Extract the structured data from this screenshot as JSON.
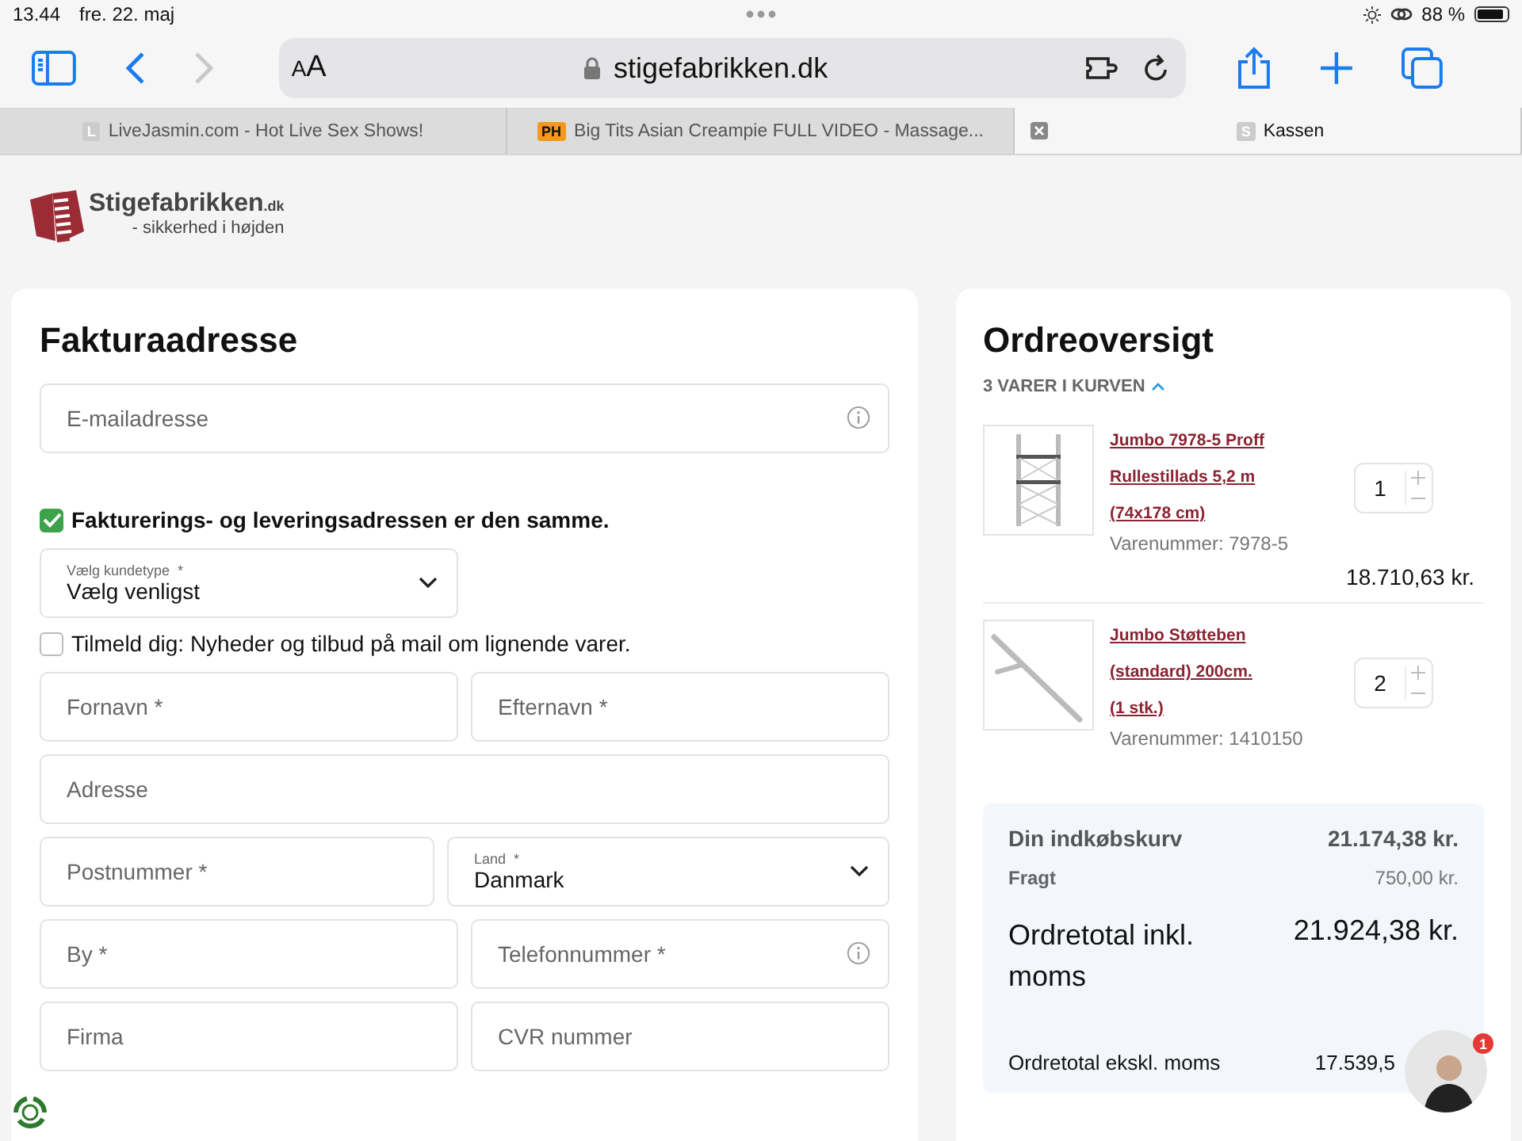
{
  "status_bar": {
    "time": "13.44",
    "date": "fre. 22. maj",
    "battery": "88 %"
  },
  "toolbar": {
    "text_size": "AA",
    "address": "stigefabrikken.dk"
  },
  "tabs": [
    {
      "favicon": "L",
      "label": "LiveJasmin.com - Hot Live Sex Shows!",
      "selected": false
    },
    {
      "favicon": "PH",
      "label": "Big Tits Asian Creampie FULL VIDEO - Massage...",
      "selected": false
    },
    {
      "favicon": "S",
      "label": "Kassen",
      "selected": true
    }
  ],
  "logo": {
    "name": "Stigefabrikken",
    "suffix": ".dk",
    "tagline": "- sikkerhed i højden"
  },
  "billing": {
    "title": "Fakturaadresse",
    "rows": [
      {
        "kind": "fields",
        "fields": [
          {
            "kind": "input",
            "placeholder": "E-mailadresse",
            "info": true
          }
        ]
      },
      {
        "kind": "checkbox",
        "label": "Fakturerings- og leveringsadressen er den samme.",
        "checked": true,
        "bold": true
      },
      {
        "kind": "fields",
        "half": true,
        "fields": [
          {
            "kind": "select",
            "label": "Vælg kundetype  *",
            "value": "Vælg venligst"
          }
        ]
      },
      {
        "kind": "checkbox",
        "label": "Tilmeld dig: Nyheder og tilbud på mail om lignende varer.",
        "checked": false,
        "bold": false
      },
      {
        "kind": "fields",
        "fields": [
          {
            "kind": "input",
            "placeholder": "Fornavn *"
          },
          {
            "kind": "input",
            "placeholder": "Efternavn *"
          }
        ]
      },
      {
        "kind": "fields",
        "fields": [
          {
            "kind": "input",
            "placeholder": "Adresse"
          }
        ]
      },
      {
        "kind": "fields",
        "fields": [
          {
            "kind": "input",
            "placeholder": "Postnummer *"
          },
          {
            "kind": "select",
            "label": "Land  *",
            "value": "Danmark"
          }
        ]
      },
      {
        "kind": "fields",
        "fields": [
          {
            "kind": "input",
            "placeholder": "By *"
          },
          {
            "kind": "input",
            "placeholder": "Telefonnummer *",
            "info": true
          }
        ]
      },
      {
        "kind": "fields",
        "fields": [
          {
            "kind": "input",
            "placeholder": "Firma"
          },
          {
            "kind": "input",
            "placeholder": "CVR nummer"
          }
        ]
      }
    ]
  },
  "order": {
    "title": "Ordreoversigt",
    "count": "3 VARER I KURVEN",
    "expanded": true,
    "items": [
      {
        "kind": "scaffold",
        "name": "Jumbo 7978-5 Proff Rullestillads 5,2 m (74x178 cm)",
        "sku": "Varenummer: 7978-5",
        "quantity": "1",
        "price": "18.710,63 kr."
      },
      {
        "kind": "leg",
        "name": "Jumbo Støtteben (standard) 200cm. (1 stk.)",
        "sku": "Varenummer: 1410150",
        "quantity": "2"
      }
    ],
    "summary": [
      {
        "kind": "subtotal",
        "label": "Din indkøbskurv",
        "value": "21.174,38 kr."
      },
      {
        "kind": "minor",
        "label": "Fragt",
        "value": "750,00 kr."
      },
      {
        "kind": "total",
        "label": "Ordretotal inkl. moms",
        "value": "21.924,38 kr."
      },
      {
        "kind": "plain",
        "label": "Ordretotal ekskl. moms",
        "value": "17.539,5"
      }
    ]
  },
  "chat": {
    "badge": "1"
  }
}
